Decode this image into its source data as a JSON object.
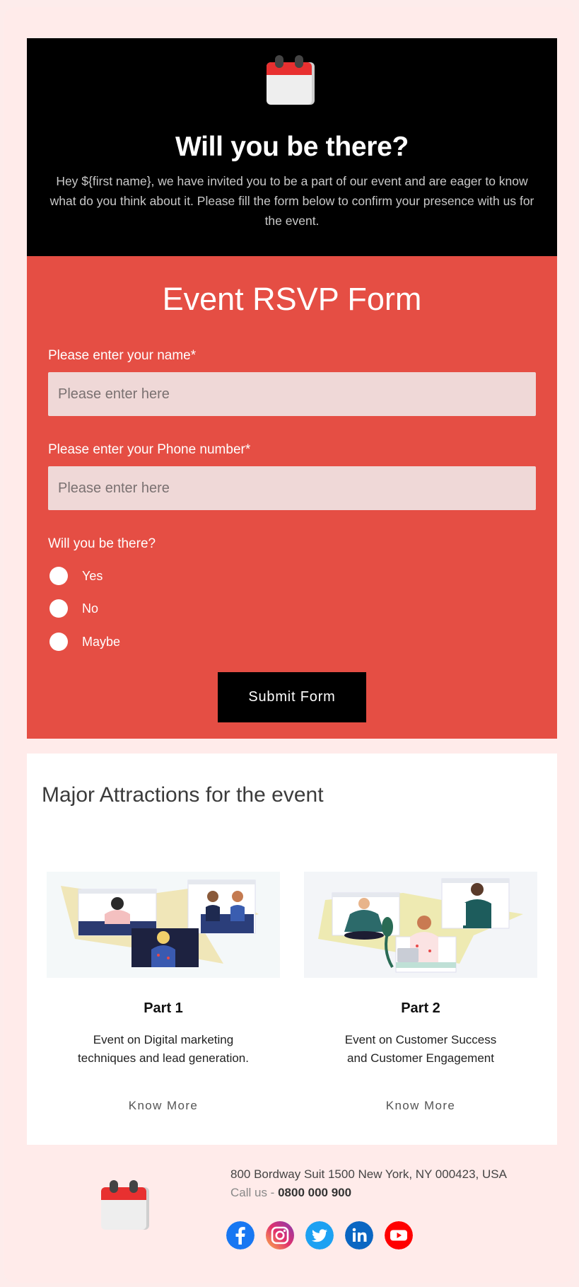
{
  "hero": {
    "title": "Will you be there?",
    "description": "Hey ${first name}, we have invited you to be a part of our event and are eager to know what do you think about it. Please fill the form below to confirm your presence with us for the event."
  },
  "form": {
    "title": "Event RSVP Form",
    "name_label": "Please enter your name*",
    "name_placeholder": "Please enter here",
    "phone_label": "Please enter your Phone number*",
    "phone_placeholder": "Please enter here",
    "attend_label": "Will you be there?",
    "options": [
      "Yes",
      "No",
      "Maybe"
    ],
    "submit_label": "Submit Form"
  },
  "attractions": {
    "title": "Major Attractions for the event",
    "cards": [
      {
        "title": "Part 1",
        "desc_line1": "Event on Digital marketing",
        "desc_line2": "techniques and lead generation.",
        "link": "Know More"
      },
      {
        "title": "Part 2",
        "desc_line1": "Event on Customer Success",
        "desc_line2": "and Customer Engagement",
        "link": "Know More"
      }
    ]
  },
  "footer": {
    "address": "800 Bordway Suit 1500 New York, NY 000423, USA",
    "call_prefix": "Call us - ",
    "phone": "0800 000 900",
    "social_icons": [
      "facebook-icon",
      "instagram-icon",
      "twitter-icon",
      "linkedin-icon",
      "youtube-icon"
    ]
  },
  "colors": {
    "page_bg": "#ffebea",
    "hero_bg": "#000000",
    "form_bg": "#e54e44",
    "input_bg": "#efd8d7",
    "button_bg": "#000000"
  }
}
